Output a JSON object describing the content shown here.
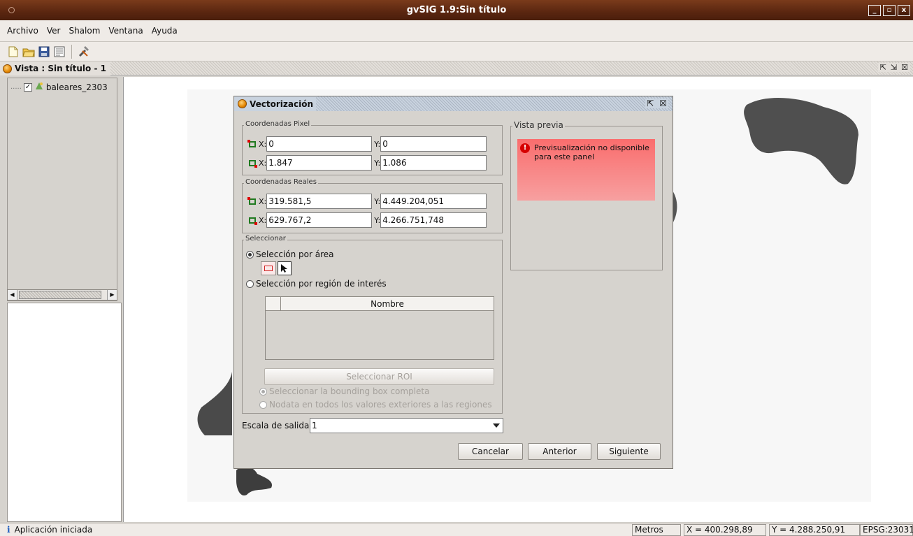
{
  "window": {
    "title": "gvSIG 1.9:Sin título",
    "buttons": [
      "_",
      "▫",
      "x"
    ]
  },
  "menu": [
    "Archivo",
    "Ver",
    "Shalom",
    "Ventana",
    "Ayuda"
  ],
  "view": {
    "title": "Vista : Sin título - 1",
    "layer_name": "baleares_2303"
  },
  "dialog": {
    "title": "Vectorización",
    "pixel": {
      "legend": "Coordenadas Pixel",
      "x1": "0",
      "y1": "0",
      "x2": "1.847",
      "y2": "1.086"
    },
    "real": {
      "legend": "Coordenadas Reales",
      "x1": "319.581,5",
      "y1": "4.449.204,051",
      "x2": "629.767,2",
      "y2": "4.266.751,748"
    },
    "labels": {
      "x": "X:",
      "y": "Y:"
    },
    "select": {
      "legend": "Seleccionar",
      "by_area": "Selección por área",
      "by_roi": "Selección por región de interés",
      "column_name": "Nombre",
      "select_roi_button": "Seleccionar ROI",
      "bbox_option": "Seleccionar la bounding box completa",
      "nodata_option": "Nodata en todos los valores exteriores a las regiones"
    },
    "preview": {
      "legend": "Vista previa",
      "message": "Previsualización no disponible para este panel"
    },
    "scale": {
      "label": "Escala de salida",
      "value": "1"
    },
    "buttons": {
      "cancel": "Cancelar",
      "previous": "Anterior",
      "next": "Siguiente"
    }
  },
  "status": {
    "message": "Aplicación iniciada",
    "units": "Metros",
    "x": "X = 400.298,89",
    "y": "Y = 4.288.250,91",
    "epsg": "EPSG:23031"
  },
  "colors": {
    "titlebar": "#5a2610",
    "preview_error": "#fa6d6d",
    "point_box": "#207a20"
  }
}
